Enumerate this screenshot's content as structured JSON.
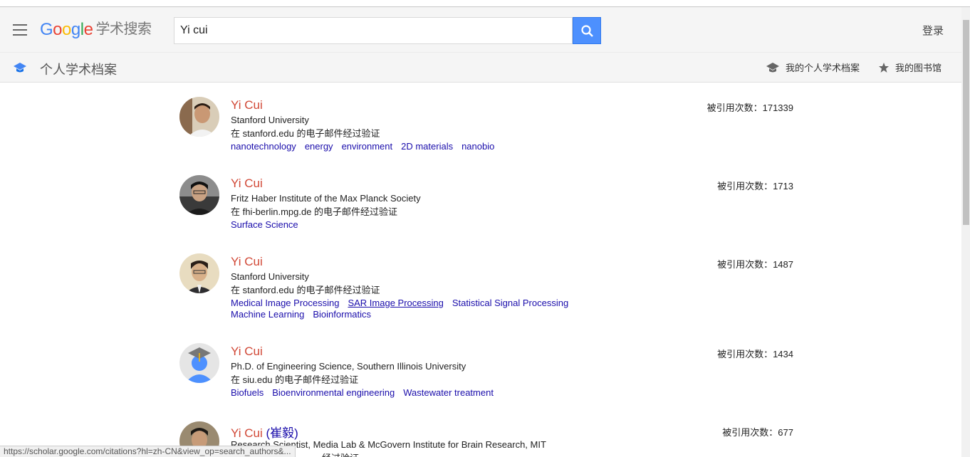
{
  "header": {
    "logo_g1": "G",
    "logo_o1": "o",
    "logo_o2": "o",
    "logo_g2": "g",
    "logo_l": "l",
    "logo_e": "e",
    "logo_scholar": "学术搜索",
    "search_value": "Yi cui",
    "login_label": "登录"
  },
  "subheader": {
    "title": "个人学术档案",
    "my_profile": "我的个人学术档案",
    "my_library": "我的图书馆"
  },
  "results": [
    {
      "name": "Yi Cui",
      "name_cn": "",
      "affiliation": "Stanford University",
      "email": "在 stanford.edu 的电子邮件经过验证",
      "citations": "被引用次数：171339",
      "tags": [
        "nanotechnology",
        "energy",
        "environment",
        "2D materials",
        "nanobio"
      ]
    },
    {
      "name": "Yi Cui",
      "name_cn": "",
      "affiliation": "Fritz Haber Institute of the Max Planck Society",
      "email": "在 fhi-berlin.mpg.de 的电子邮件经过验证",
      "citations": "被引用次数：1713",
      "tags": [
        "Surface Science"
      ]
    },
    {
      "name": "Yi Cui",
      "name_cn": "",
      "affiliation": "Stanford University",
      "email": "在 stanford.edu 的电子邮件经过验证",
      "citations": "被引用次数：1487",
      "tags": [
        "Medical Image Processing",
        "SAR Image Processing",
        "Statistical Signal Processing",
        "Machine Learning",
        "Bioinformatics"
      ]
    },
    {
      "name": "Yi Cui",
      "name_cn": "",
      "affiliation": "Ph.D. of Engineering Science, Southern Illinois University",
      "email": "在 siu.edu 的电子邮件经过验证",
      "citations": "被引用次数：1434",
      "tags": [
        "Biofuels",
        "Bioenvironmental engineering",
        "Wastewater treatment"
      ]
    },
    {
      "name": "Yi Cui",
      "name_cn": "(崔毅)",
      "affiliation": "Research Scientist, Media Lab & McGovern Institute for Brain Research, MIT",
      "email": "经过验证",
      "citations": "被引用次数：677",
      "tags": []
    }
  ],
  "status_bar": "https://scholar.google.com/citations?hl=zh-CN&view_op=search_authors&..."
}
